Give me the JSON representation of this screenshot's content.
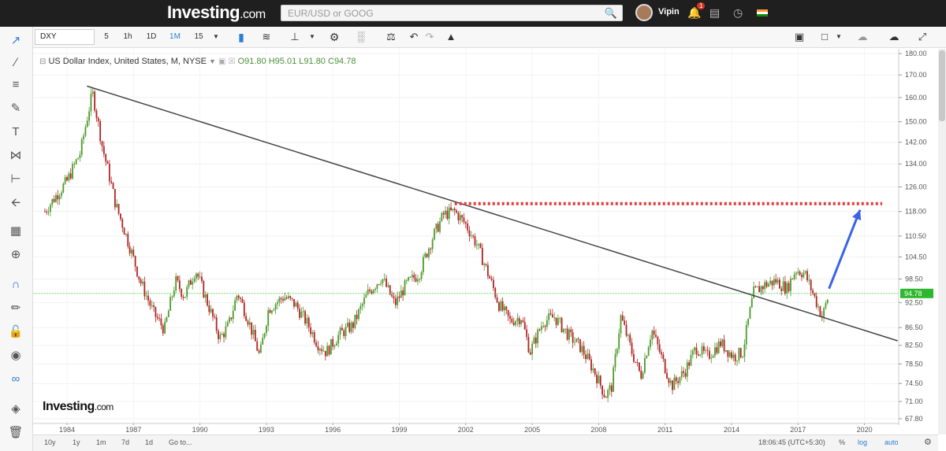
{
  "topbar": {
    "brand": "Investing",
    "brand_suffix": ".com",
    "search_placeholder": "EUR/USD or GOOG",
    "username": "Vipin",
    "notification_count": "1"
  },
  "toolbar": {
    "symbol": "DXY",
    "intervals": [
      "5",
      "1h",
      "1D",
      "1M",
      "15"
    ],
    "active_interval": "1M"
  },
  "legend": {
    "title": "US Dollar Index, United States, M, NYSE",
    "open": "O91.80",
    "high": "H95.01",
    "low": "L91.80",
    "close": "C94.78"
  },
  "chart_data": {
    "type": "candlestick",
    "title": "US Dollar Index, United States, M, NYSE",
    "x_ticks": [
      "1984",
      "1987",
      "1990",
      "1993",
      "1996",
      "1999",
      "2002",
      "2005",
      "2008",
      "2011",
      "2014",
      "2017",
      "2020"
    ],
    "y_ticks": [
      "180.00",
      "170.00",
      "160.00",
      "150.00",
      "142.00",
      "134.00",
      "126.00",
      "118.00",
      "110.50",
      "104.50",
      "98.50",
      "92.50",
      "86.50",
      "82.50",
      "78.50",
      "74.50",
      "71.00",
      "67.80"
    ],
    "ylim": [
      67.8,
      180
    ],
    "scale": "log",
    "last_price": "94.78",
    "price_path": [
      [
        1983.0,
        118
      ],
      [
        1984.0,
        128
      ],
      [
        1984.6,
        138
      ],
      [
        1985.15,
        162
      ],
      [
        1985.6,
        140
      ],
      [
        1986.2,
        120
      ],
      [
        1986.8,
        108
      ],
      [
        1987.3,
        98
      ],
      [
        1987.9,
        90
      ],
      [
        1988.4,
        86
      ],
      [
        1988.9,
        98
      ],
      [
        1989.3,
        94
      ],
      [
        1989.8,
        101
      ],
      [
        1990.3,
        93
      ],
      [
        1990.9,
        84
      ],
      [
        1991.3,
        87
      ],
      [
        1991.7,
        95
      ],
      [
        1992.2,
        88
      ],
      [
        1992.7,
        80
      ],
      [
        1993.1,
        91
      ],
      [
        1993.8,
        94
      ],
      [
        1994.3,
        92
      ],
      [
        1994.9,
        87
      ],
      [
        1995.3,
        83
      ],
      [
        1995.7,
        81
      ],
      [
        1996.3,
        85
      ],
      [
        1996.9,
        87
      ],
      [
        1997.6,
        95
      ],
      [
        1998.2,
        99
      ],
      [
        1998.8,
        92
      ],
      [
        1999.3,
        97
      ],
      [
        1999.9,
        100
      ],
      [
        2000.5,
        110
      ],
      [
        2001.0,
        117
      ],
      [
        2001.5,
        118
      ],
      [
        2002.0,
        114
      ],
      [
        2002.5,
        108
      ],
      [
        2003.0,
        100
      ],
      [
        2003.5,
        92
      ],
      [
        2004.0,
        88
      ],
      [
        2004.5,
        89
      ],
      [
        2004.9,
        81
      ],
      [
        2005.5,
        88
      ],
      [
        2006.0,
        89
      ],
      [
        2006.6,
        85
      ],
      [
        2007.2,
        82
      ],
      [
        2007.8,
        77
      ],
      [
        2008.3,
        72
      ],
      [
        2008.6,
        74
      ],
      [
        2009.0,
        89
      ],
      [
        2009.5,
        81
      ],
      [
        2009.9,
        76
      ],
      [
        2010.4,
        86
      ],
      [
        2010.9,
        79
      ],
      [
        2011.3,
        74
      ],
      [
        2011.9,
        77
      ],
      [
        2012.4,
        82
      ],
      [
        2012.9,
        80
      ],
      [
        2013.5,
        83
      ],
      [
        2014.1,
        80
      ],
      [
        2014.5,
        81
      ],
      [
        2015.0,
        95
      ],
      [
        2015.5,
        97
      ],
      [
        2016.0,
        98
      ],
      [
        2016.5,
        96
      ],
      [
        2016.9,
        101
      ],
      [
        2017.3,
        100
      ],
      [
        2017.8,
        93
      ],
      [
        2018.1,
        89
      ],
      [
        2018.4,
        94.78
      ]
    ],
    "trendline": {
      "from": [
        1984.9,
        165
      ],
      "to": [
        2021.5,
        83.5
      ],
      "color": "#444444"
    },
    "resistance": {
      "from": [
        2001.5,
        120.5
      ],
      "to": [
        2020.8,
        120.5
      ],
      "style": "dotted",
      "color": "#e03c3c"
    },
    "arrow": {
      "from": [
        2018.4,
        96
      ],
      "to": [
        2019.8,
        118.5
      ],
      "color": "#3b63e8"
    },
    "colors": {
      "up": "#4c9a2a",
      "down": "#b22222",
      "price_line": "#3cc43c",
      "last_price_bg": "#2eb82e"
    }
  },
  "bottombar": {
    "ranges": [
      "10y",
      "1y",
      "1m",
      "7d",
      "1d",
      "Go to..."
    ],
    "time": "18:06:45 (UTC+5:30)",
    "options": [
      "%",
      "log",
      "auto"
    ]
  },
  "watermark": {
    "brand": "Investing",
    "suffix": ".com"
  }
}
